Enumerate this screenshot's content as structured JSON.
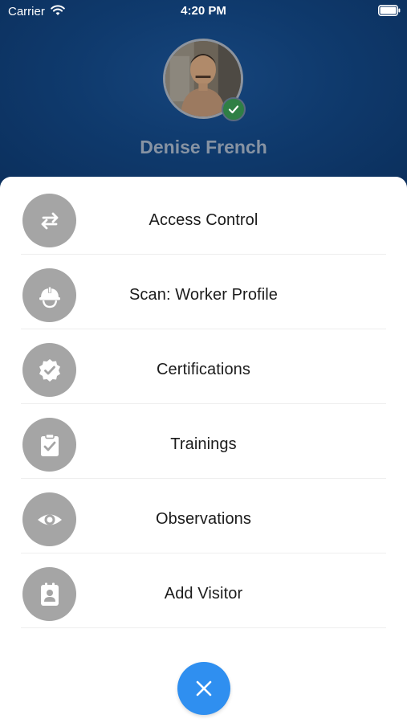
{
  "status_bar": {
    "carrier": "Carrier",
    "time": "4:20 PM"
  },
  "profile": {
    "name": "Denise French",
    "verified": true
  },
  "menu": {
    "items": [
      {
        "label": "Access Control",
        "icon": "swap-arrows-icon"
      },
      {
        "label": "Scan: Worker Profile",
        "icon": "hard-hat-icon"
      },
      {
        "label": "Certifications",
        "icon": "certificate-badge-icon"
      },
      {
        "label": "Trainings",
        "icon": "clipboard-check-icon"
      },
      {
        "label": "Observations",
        "icon": "eye-icon"
      },
      {
        "label": "Add Visitor",
        "icon": "contact-badge-icon"
      }
    ]
  },
  "colors": {
    "header_bg": "#0f3a6d",
    "icon_bg": "#a5a5a5",
    "close_button": "#2f8ff0",
    "verified_badge": "#2f7f45"
  },
  "close_button": {
    "icon": "close-icon"
  }
}
